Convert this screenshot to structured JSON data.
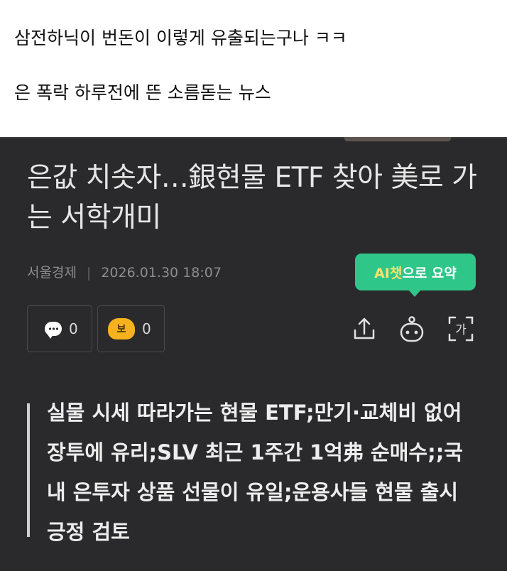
{
  "post": {
    "line1": "삼전하닉이 번돈이 이렇게 유출되는구나 ㅋㅋ",
    "line2": "은 폭락 하루전에 뜬 소름돋는 뉴스"
  },
  "article": {
    "headline": "은값 치솟자…銀현물 ETF 찾아 美로 가는 서학개미",
    "source": "서울경제",
    "timestamp": "2026.01.30 18:07",
    "ai_tooltip": {
      "prefix": "AI챗",
      "suffix": "으로 요약"
    },
    "comment_count": "0",
    "reaction_count": "0",
    "reaction_icon_label": "보",
    "translate_icon_label": "가",
    "summary": "실물 시세 따라가는 현물 ETF;만기·교체비 없어 장투에 유리;SLV 최근 1주간 1억弗 순매수;;국내 은투자 상품 선물이 유일;운용사들 현물 출시 긍정 검토"
  },
  "colors": {
    "dark_background": "#2a2a2c",
    "ai_tooltip_green": "#2fc689",
    "reaction_yellow": "#f5b21c"
  }
}
